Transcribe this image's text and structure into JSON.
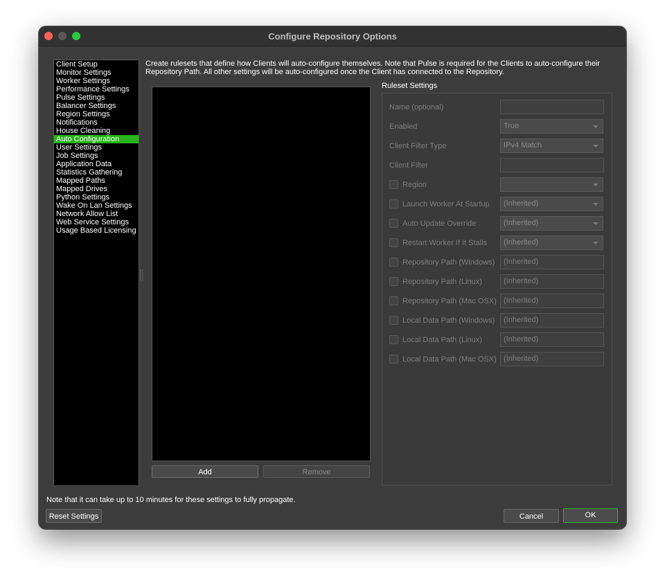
{
  "window": {
    "title": "Configure Repository Options"
  },
  "nav": {
    "items": [
      "Client Setup",
      "Monitor Settings",
      "Worker Settings",
      "Performance Settings",
      "Pulse Settings",
      "Balancer Settings",
      "Region Settings",
      "Notifications",
      "House Cleaning",
      "Auto Configuration",
      "User Settings",
      "Job Settings",
      "Application Data",
      "Statistics Gathering",
      "Mapped Paths",
      "Mapped Drives",
      "Python Settings",
      "Wake On Lan Settings",
      "Network Allow List",
      "Web Service Settings",
      "Usage Based Licensing"
    ],
    "selected": "Auto Configuration"
  },
  "description": "Create rulesets that define how Clients will auto-configure themselves. Note that Pulse is required for the Clients to auto-configure their Repository Path. All other settings will be auto-configured once the Client has connected to the Repository.",
  "ruleset": {
    "add_label": "Add",
    "remove_label": "Remove"
  },
  "settings": {
    "title": "Ruleset Settings",
    "rows": [
      {
        "label": "Name (optional)",
        "checkbox": false,
        "control": "text",
        "value": ""
      },
      {
        "label": "Enabled",
        "checkbox": false,
        "control": "combo",
        "value": "True"
      },
      {
        "label": "Client Filter Type",
        "checkbox": false,
        "control": "combo",
        "value": "IPv4 Match"
      },
      {
        "label": "Client Filter",
        "checkbox": false,
        "control": "text",
        "value": ""
      },
      {
        "label": "Region",
        "checkbox": true,
        "control": "combo",
        "value": ""
      },
      {
        "label": "Launch Worker At Startup",
        "checkbox": true,
        "control": "combo",
        "value": "(Inherited)"
      },
      {
        "label": "Auto Update Override",
        "checkbox": true,
        "control": "combo",
        "value": "(Inherited)"
      },
      {
        "label": "Restart Worker If It Stalls",
        "checkbox": true,
        "control": "combo",
        "value": "(Inherited)"
      },
      {
        "label": "Repository Path (Windows)",
        "checkbox": true,
        "control": "text",
        "value": "(Inherited)"
      },
      {
        "label": "Repository Path (Linux)",
        "checkbox": true,
        "control": "text",
        "value": "(Inherited)"
      },
      {
        "label": "Repository Path (Mac OSX)",
        "checkbox": true,
        "control": "text",
        "value": "(Inherited)"
      },
      {
        "label": "Local Data Path (Windows)",
        "checkbox": true,
        "control": "text",
        "value": "(Inherited)"
      },
      {
        "label": "Local Data Path (Linux)",
        "checkbox": true,
        "control": "text",
        "value": "(Inherited)"
      },
      {
        "label": "Local Data Path (Mac OSX)",
        "checkbox": true,
        "control": "text",
        "value": "(Inherited)"
      }
    ]
  },
  "footer": {
    "note": "Note that it can take up to 10 minutes for these settings to fully propagate.",
    "reset_label": "Reset Settings",
    "cancel_label": "Cancel",
    "ok_label": "OK"
  },
  "colors": {
    "selection": "#27b41b",
    "window_bg": "#3c3c3c",
    "ok_border": "#3aa83a"
  }
}
